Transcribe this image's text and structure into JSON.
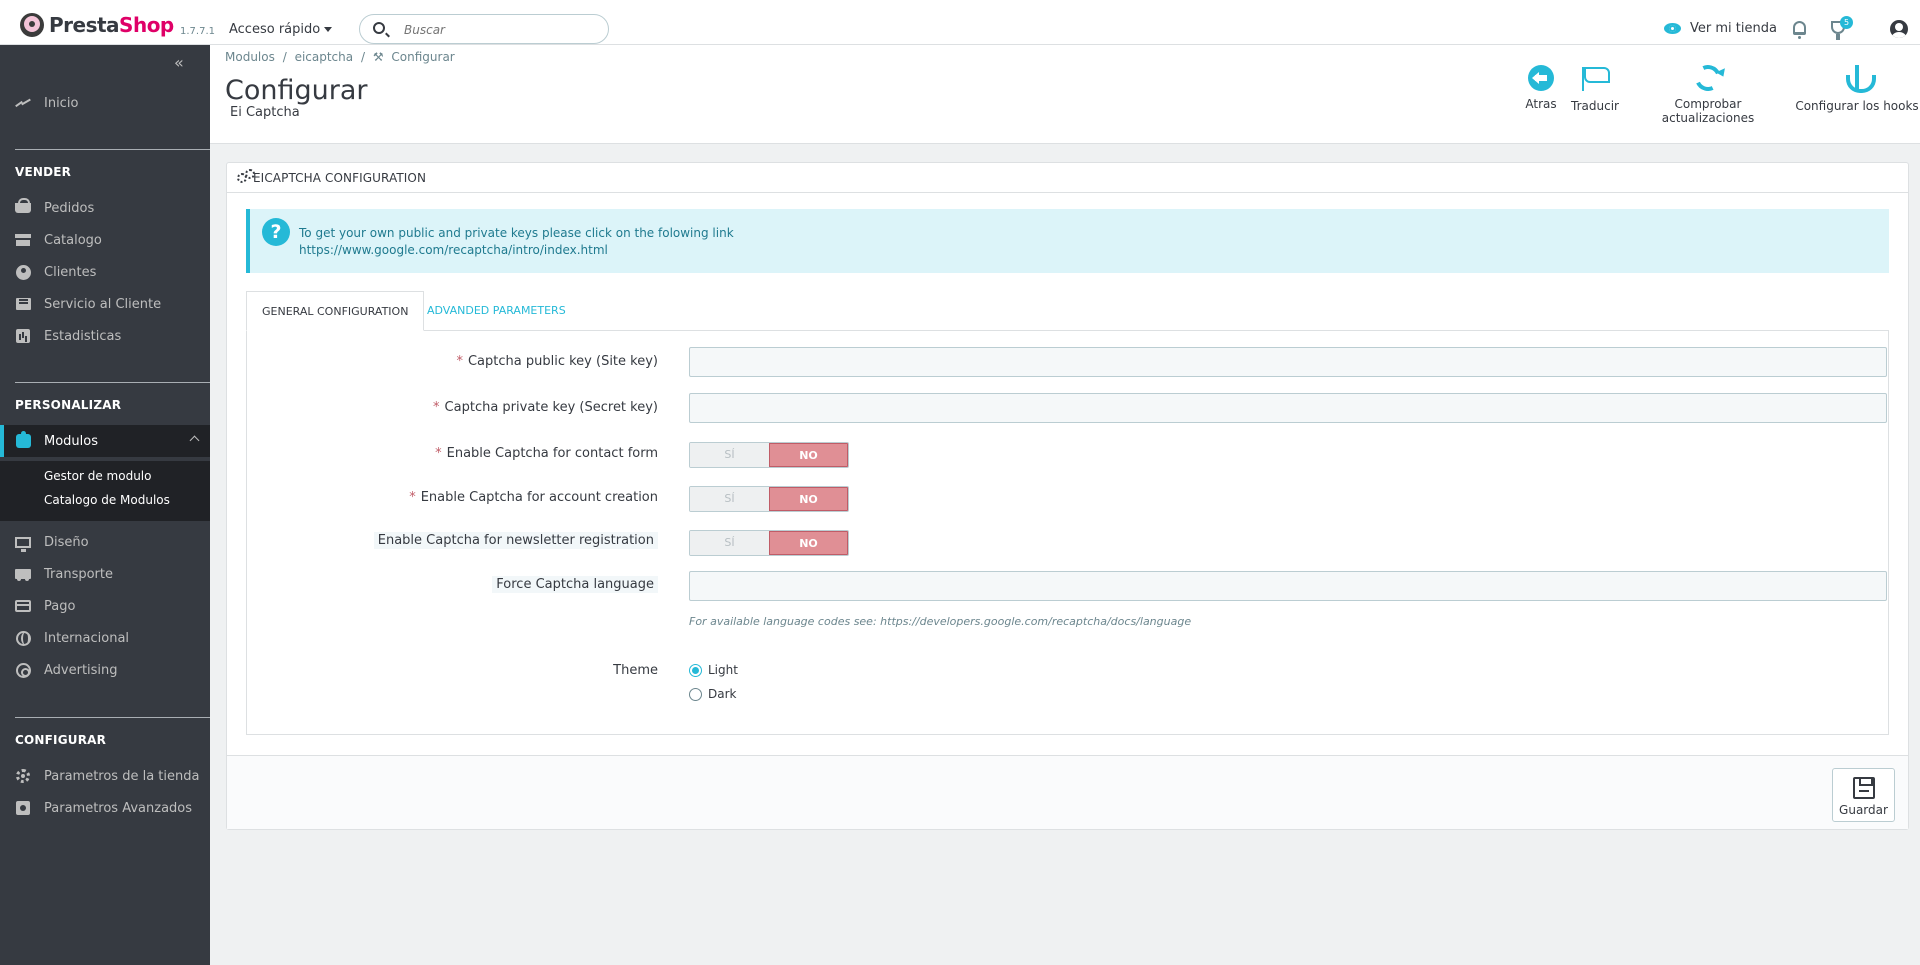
{
  "header": {
    "logo_part1": "Presta",
    "logo_part2": "Shop",
    "version": "1.7.7.1",
    "quick_access": "Acceso rápido",
    "search_placeholder": "Buscar",
    "view_store": "Ver mi tienda",
    "orders_badge": "5"
  },
  "sidebar": {
    "home": "Inicio",
    "section_sell": "VENDER",
    "sell_items": [
      "Pedidos",
      "Catalogo",
      "Clientes",
      "Servicio al Cliente",
      "Estadisticas"
    ],
    "section_customize": "PERSONALIZAR",
    "modules": "Modulos",
    "modules_sub": [
      "Gestor de modulo",
      "Catalogo de Modulos"
    ],
    "customize_items": [
      "Diseño",
      "Transporte",
      "Pago",
      "Internacional",
      "Advertising"
    ],
    "section_configure": "CONFIGURAR",
    "configure_items": [
      "Parametros de la tienda",
      "Parametros Avanzados"
    ]
  },
  "page": {
    "breadcrumb": [
      "Modulos",
      "/",
      "eicaptcha",
      "/",
      "Configurar"
    ],
    "title": "Configurar",
    "subtitle": "Ei Captcha",
    "toolbar": {
      "back": "Atras",
      "translate": "Traducir",
      "check_updates": "Comprobar actualizaciones",
      "configure_hooks": "Configurar los hooks"
    }
  },
  "panel": {
    "heading": "EICAPTCHA CONFIGURATION",
    "alert_line1": "To get your own public and private keys please click on the folowing link",
    "alert_link": "https://www.google.com/recaptcha/intro/index.html",
    "tabs": [
      "GENERAL CONFIGURATION",
      "ADVANDED PARAMETERS"
    ],
    "fields": {
      "public_key_label": "Captcha public key (Site key)",
      "private_key_label": "Captcha private key (Secret key)",
      "contact_label": "Enable Captcha for contact form",
      "account_label": "Enable Captcha for account creation",
      "newsletter_label": "Enable Captcha for newsletter registration",
      "language_label": "Force Captcha language",
      "language_help": "For available language codes see: https://developers.google.com/recaptcha/docs/language",
      "theme_label": "Theme",
      "theme_options": [
        "Light",
        "Dark"
      ],
      "switch_yes": "SÍ",
      "switch_no": "NO"
    },
    "save": "Guardar"
  },
  "colors": {
    "accent": "#25b9d7",
    "sidebar_bg": "#363a41",
    "switch_no": "#e08f95"
  }
}
